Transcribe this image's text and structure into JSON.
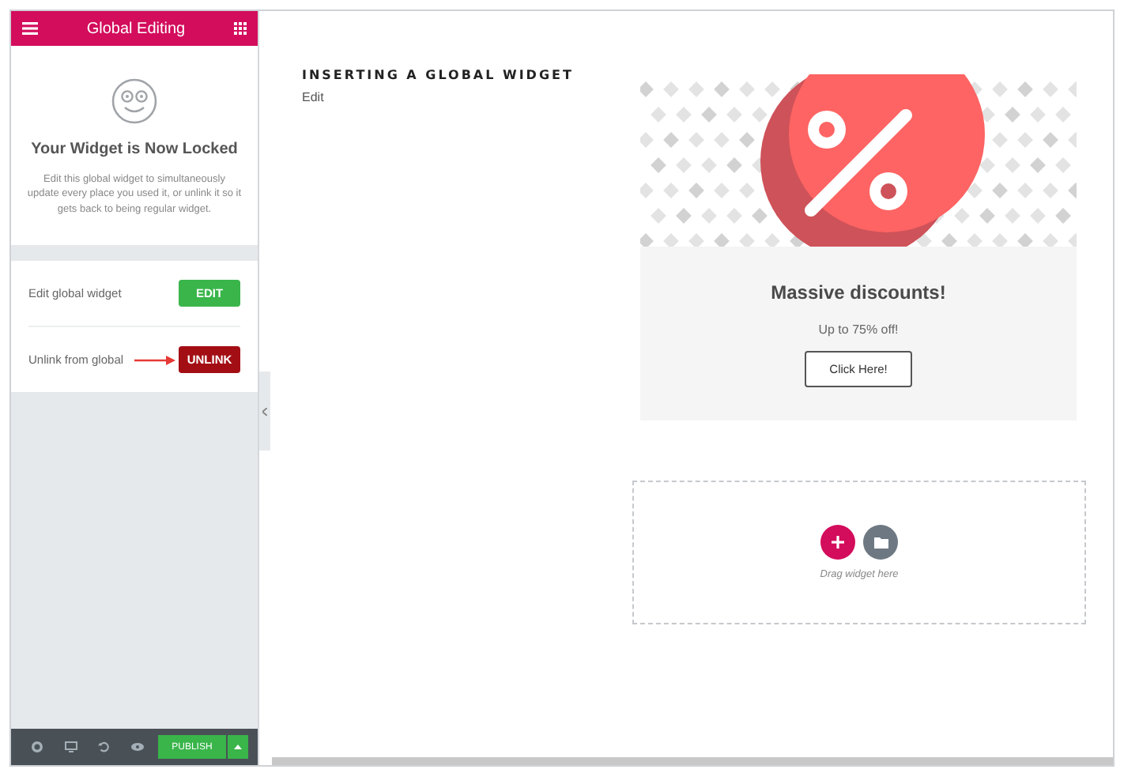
{
  "panel": {
    "title": "Global Editing",
    "heading": "Your Widget is Now Locked",
    "description": "Edit this global widget to simultaneously update every place you used it, or unlink it so it gets back to being regular widget.",
    "actions": [
      {
        "label": "Edit global widget",
        "button": "EDIT",
        "kind": "edit"
      },
      {
        "label": "Unlink from global",
        "button": "UNLINK",
        "kind": "unlink"
      }
    ],
    "footer": {
      "publish": "PUBLISH"
    }
  },
  "canvas": {
    "title": "INSERTING A GLOBAL WIDGET",
    "edit_link": "Edit",
    "promo": {
      "heading": "Massive discounts!",
      "text": "Up to 75% off!",
      "button": "Click Here!"
    },
    "dropzone": {
      "hint": "Drag widget here"
    }
  }
}
